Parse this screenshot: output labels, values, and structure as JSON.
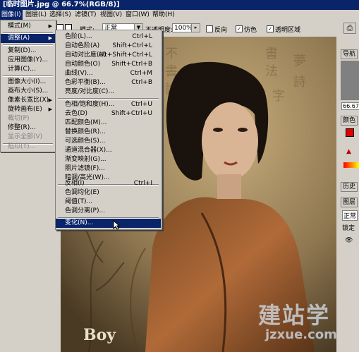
{
  "window": {
    "title": "[临时图片.jpg @ 66.7%(RGB/8)]"
  },
  "menubar": {
    "items": [
      {
        "label": "图像(I)",
        "active": true
      },
      {
        "label": "图层(L)"
      },
      {
        "label": "选择(S)"
      },
      {
        "label": "滤镜(T)"
      },
      {
        "label": "视图(V)"
      },
      {
        "label": "窗口(W)"
      },
      {
        "label": "帮助(H)"
      }
    ]
  },
  "options": {
    "mode_label": "模式:",
    "mode_value": "正常",
    "opacity_label": "不透明度:",
    "opacity_value": "100%",
    "reverse_label": "反向",
    "dither_label": "仿色",
    "transparency_label": "透明区域"
  },
  "image_menu": {
    "items": [
      {
        "label": "模式(M)",
        "submenu": true
      },
      {
        "label": "调整(A)",
        "submenu": true,
        "highlighted": true
      },
      {
        "label": "复制(D)..."
      },
      {
        "label": "应用图像(Y)..."
      },
      {
        "label": "计算(C)..."
      },
      {
        "label": "图像大小(I)..."
      },
      {
        "label": "画布大小(S)..."
      },
      {
        "label": "像素长宽比(X)",
        "submenu": true
      },
      {
        "label": "旋转画布(E)",
        "submenu": true
      },
      {
        "label": "裁切(P)",
        "disabled": true
      },
      {
        "label": "修整(R)..."
      },
      {
        "label": "显示全部(V)",
        "disabled": true
      },
      {
        "label": "陷印(T)...",
        "disabled": true
      }
    ]
  },
  "adjust_menu": {
    "items": [
      {
        "label": "色阶(L)...",
        "shortcut": "Ctrl+L"
      },
      {
        "label": "自动色阶(A)",
        "shortcut": "Shift+Ctrl+L"
      },
      {
        "label": "自动对比度(U)",
        "shortcut": "Alt+Shift+Ctrl+L"
      },
      {
        "label": "自动颜色(O)",
        "shortcut": "Shift+Ctrl+B"
      },
      {
        "label": "曲线(V)...",
        "shortcut": "Ctrl+M"
      },
      {
        "label": "色彩平衡(B)...",
        "shortcut": "Ctrl+B"
      },
      {
        "label": "亮度/对比度(C)...",
        "shortcut": ""
      },
      {
        "label": "色相/饱和度(H)...",
        "shortcut": "Ctrl+U"
      },
      {
        "label": "去色(D)",
        "shortcut": "Shift+Ctrl+U"
      },
      {
        "label": "匹配颜色(M)...",
        "shortcut": ""
      },
      {
        "label": "替换颜色(R)...",
        "shortcut": ""
      },
      {
        "label": "可选颜色(S)...",
        "shortcut": ""
      },
      {
        "label": "通道混合器(X)...",
        "shortcut": ""
      },
      {
        "label": "渐变映射(G)...",
        "shortcut": ""
      },
      {
        "label": "照片滤镜(F)...",
        "shortcut": ""
      },
      {
        "label": "暗调/高光(W)...",
        "shortcut": ""
      },
      {
        "label": "反相(I)",
        "shortcut": "Ctrl+I"
      },
      {
        "label": "色调均化(E)",
        "shortcut": ""
      },
      {
        "label": "阈值(T)...",
        "shortcut": ""
      },
      {
        "label": "色调分离(P)...",
        "shortcut": ""
      },
      {
        "label": "变化(N)...",
        "shortcut": "",
        "highlighted": true
      }
    ]
  },
  "right_panel": {
    "navigator_tab": "导航",
    "zoom_value": "66.67",
    "color_tab": "颜色",
    "history_tab": "历史",
    "layers_tab": "图层",
    "layer_mode": "正常",
    "lock_label": "锁定"
  },
  "watermark": {
    "logo_text": "建站学",
    "url_text": "jzxue.com"
  },
  "signature": {
    "text": "Boy"
  },
  "colors": {
    "titlebar": "#0a246a",
    "highlight": "#0a246a",
    "chrome": "#d4d0c8",
    "foreground_swatch": "#e00000"
  }
}
